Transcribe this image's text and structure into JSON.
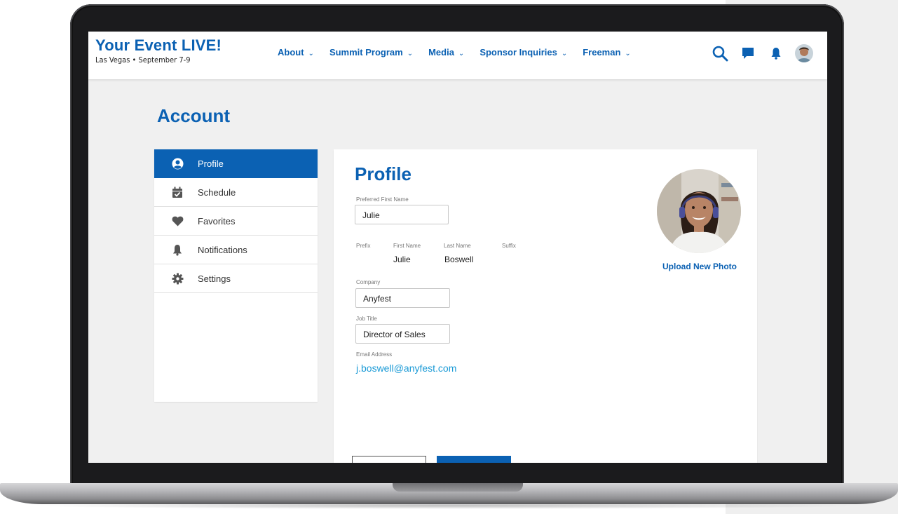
{
  "brand": {
    "title": "Your Event LIVE!",
    "subtitle": "Las Vegas • September 7-9"
  },
  "nav": {
    "items": [
      {
        "label": "About"
      },
      {
        "label": "Summit Program"
      },
      {
        "label": "Media"
      },
      {
        "label": "Sponsor Inquiries"
      },
      {
        "label": "Freeman"
      }
    ]
  },
  "header_icons": [
    "search-icon",
    "chat-icon",
    "bell-icon",
    "avatar"
  ],
  "page": {
    "title": "Account"
  },
  "sidebar": {
    "items": [
      {
        "label": "Profile",
        "icon": "user-circle-icon",
        "active": true
      },
      {
        "label": "Schedule",
        "icon": "calendar-check-icon"
      },
      {
        "label": "Favorites",
        "icon": "heart-icon"
      },
      {
        "label": "Notifications",
        "icon": "bell-icon"
      },
      {
        "label": "Settings",
        "icon": "gear-icon"
      }
    ]
  },
  "profile": {
    "title": "Profile",
    "preferred_first_name": {
      "label": "Preferred First Name",
      "value": "Julie"
    },
    "prefix": {
      "label": "Prefix",
      "value": ""
    },
    "first_name": {
      "label": "First Name",
      "value": "Julie"
    },
    "last_name": {
      "label": "Last Name",
      "value": "Boswell"
    },
    "suffix": {
      "label": "Suffix",
      "value": ""
    },
    "company": {
      "label": "Company",
      "value": "Anyfest"
    },
    "job_title": {
      "label": "Job Title",
      "value": "Director of Sales"
    },
    "email": {
      "label": "Email Address",
      "value": "j.boswell@anyfest.com"
    },
    "upload_photo_label": "Upload New Photo"
  },
  "colors": {
    "brand_blue": "#0b61b3",
    "email_link": "#1a9ad6",
    "page_bg": "#f0f0f0"
  }
}
